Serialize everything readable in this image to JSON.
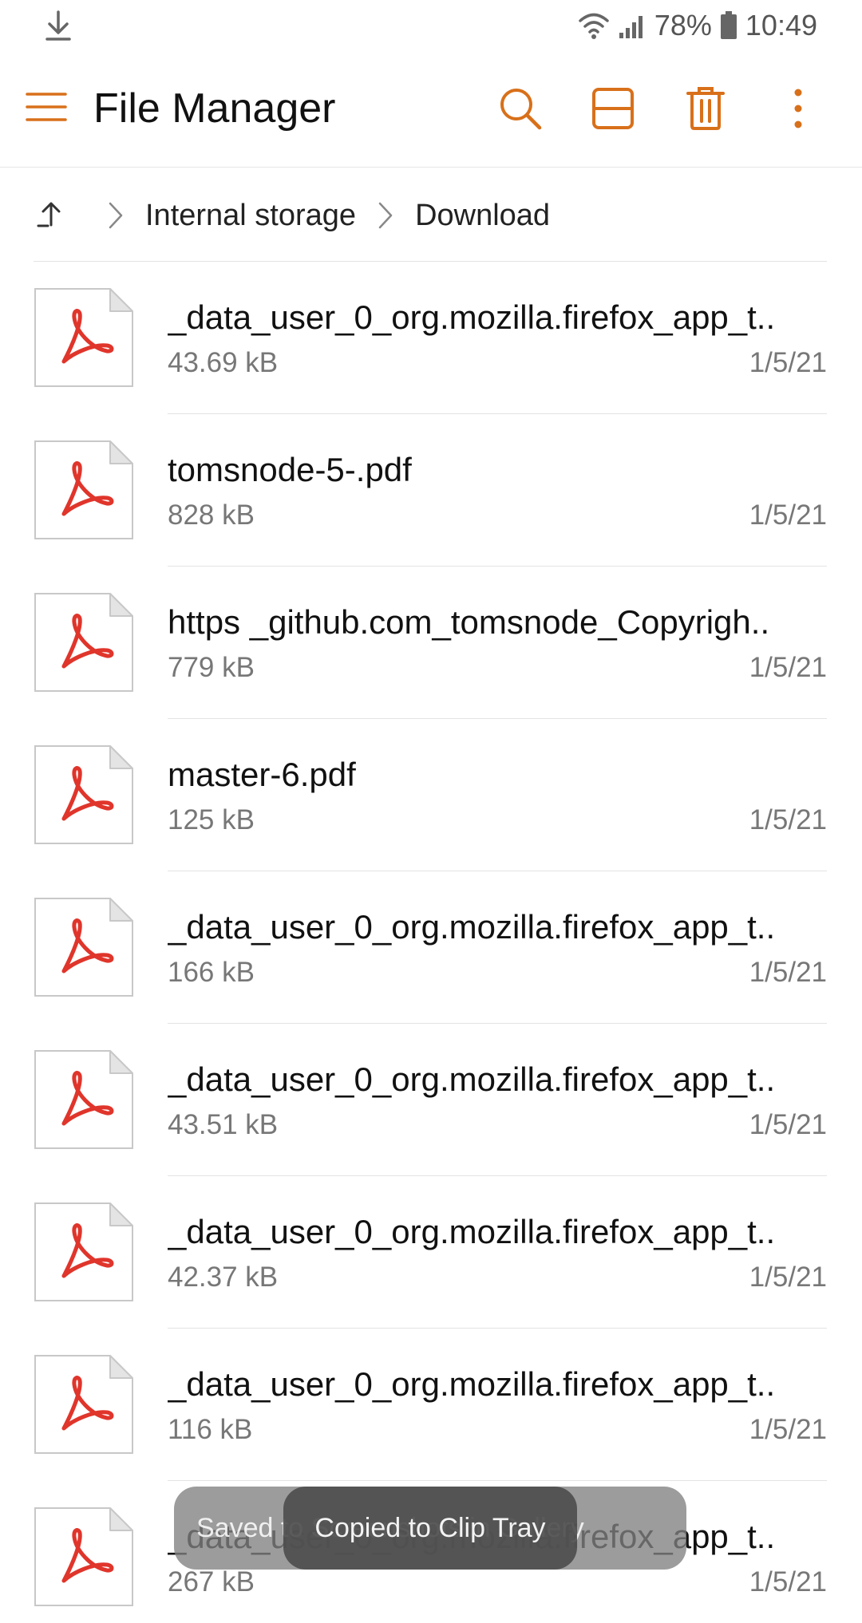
{
  "status_bar": {
    "battery": "78%",
    "time": "10:49",
    "icons": [
      "download-notification-icon",
      "wifi-icon",
      "signal-icon",
      "battery-icon"
    ]
  },
  "app_bar": {
    "title": "File Manager",
    "accent_color": "#D8701A",
    "actions": [
      "search-icon",
      "layout-icon",
      "delete-icon",
      "more-icon"
    ]
  },
  "breadcrumb": {
    "items": [
      "Internal storage",
      "Download"
    ]
  },
  "files": [
    {
      "name": "_data_user_0_org.mozilla.firefox_app_t..",
      "size": "43.69 kB",
      "date": "1/5/21"
    },
    {
      "name": "tomsnode-5-.pdf",
      "size": "828 kB",
      "date": "1/5/21"
    },
    {
      "name": "https _github.com_tomsnode_Copyrigh..",
      "size": "779 kB",
      "date": "1/5/21"
    },
    {
      "name": "master-6.pdf",
      "size": "125 kB",
      "date": "1/5/21"
    },
    {
      "name": "_data_user_0_org.mozilla.firefox_app_t..",
      "size": "166 kB",
      "date": "1/5/21"
    },
    {
      "name": "_data_user_0_org.mozilla.firefox_app_t..",
      "size": "43.51 kB",
      "date": "1/5/21"
    },
    {
      "name": "_data_user_0_org.mozilla.firefox_app_t..",
      "size": "42.37 kB",
      "date": "1/5/21"
    },
    {
      "name": "_data_user_0_org.mozilla.firefox_app_t..",
      "size": "116 kB",
      "date": "1/5/21"
    },
    {
      "name": "_data_user_0_org.mozilla.firefox_app_t..",
      "size": "267 kB",
      "date": "1/5/21"
    }
  ],
  "toasts": {
    "back": "Saved to Screenshots in Gallery",
    "front": "Copied to Clip Tray"
  },
  "pdf_icon_color": "#E0352B"
}
